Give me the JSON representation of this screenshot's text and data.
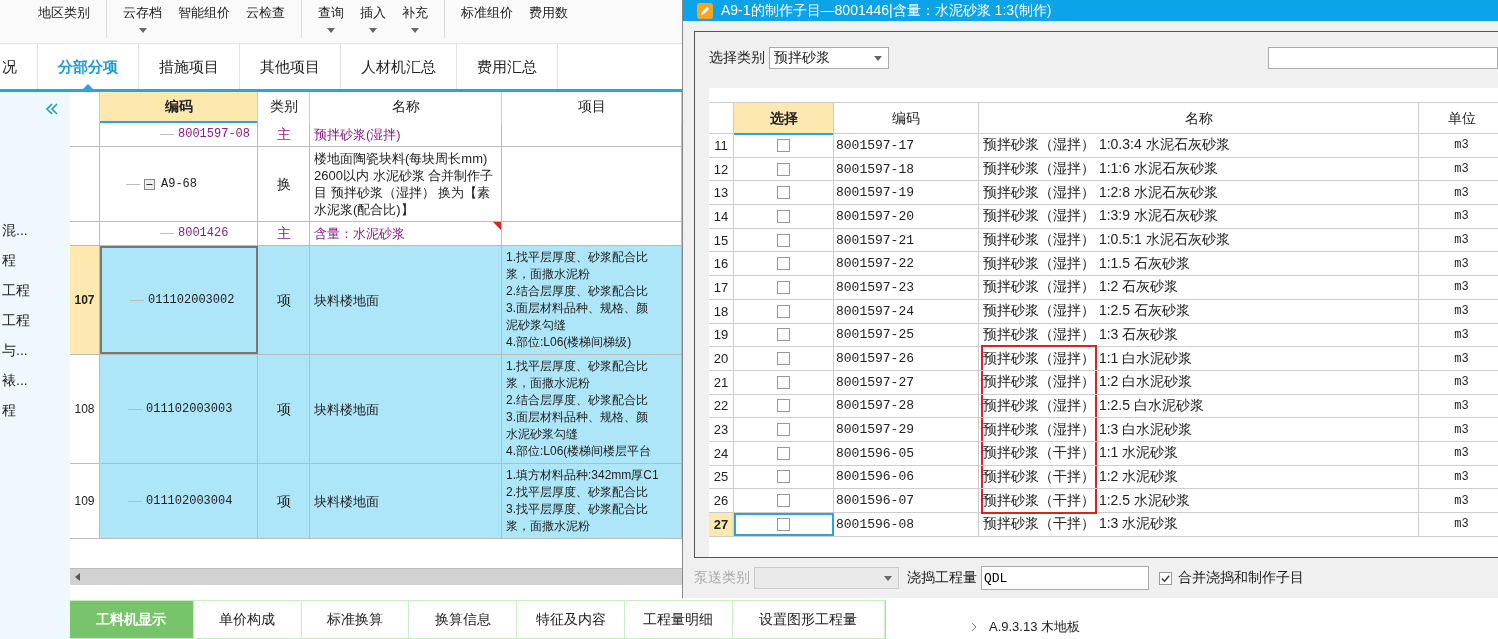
{
  "toolbar": [
    {
      "label": "地区类别",
      "caret": false
    },
    {
      "label": "云存档",
      "caret": true
    },
    {
      "label": "智能组价",
      "caret": false
    },
    {
      "label": "云检查",
      "caret": false
    },
    {
      "label": "查询",
      "caret": true
    },
    {
      "label": "插入",
      "caret": true
    },
    {
      "label": "补充",
      "caret": true
    },
    {
      "label": "标准组价",
      "caret": false
    },
    {
      "label": "费用数",
      "caret": false
    }
  ],
  "tabs": [
    {
      "label": "况",
      "selected": false
    },
    {
      "label": "分部分项",
      "selected": true
    },
    {
      "label": "措施项目",
      "selected": false
    },
    {
      "label": "其他项目",
      "selected": false
    },
    {
      "label": "人材机汇总",
      "selected": false
    },
    {
      "label": "费用汇总",
      "selected": false
    }
  ],
  "sidebar": {
    "items": [
      "混...",
      "程",
      "工程",
      "工程",
      "与...",
      "裱...",
      "程"
    ]
  },
  "grid": {
    "columns": [
      "编码",
      "类别",
      "名称",
      "项目"
    ],
    "rows": [
      {
        "kind": "material",
        "number": "",
        "code": "8001597-08",
        "type": "主",
        "name": "预拌砂浆(湿拌)",
        "selected": false,
        "has_note": false
      },
      {
        "kind": "sub",
        "number": "",
        "code": "A9-68",
        "expanded": true,
        "type": "换",
        "name": "楼地面陶瓷块料(每块周长mm) 2600以内 水泥砂浆 合并制作子目 预拌砂浆（湿拌） 换为【素水泥浆(配合比)】",
        "selected": false,
        "has_note": false
      },
      {
        "kind": "material",
        "number": "",
        "code": "8001426",
        "type": "主",
        "name": "含量：水泥砂浆",
        "selected": false,
        "has_note": true
      },
      {
        "kind": "item",
        "number": "107",
        "code": "011102003002",
        "type": "项",
        "name": "块料楼地面",
        "features": [
          "1.找平层厚度、砂浆配合比",
          "浆，面撒水泥粉",
          "2.结合层厚度、砂浆配合比",
          "3.面层材料品种、规格、颜",
          "泥砂浆勾缝",
          "4.部位:L06(楼梯间梯级)"
        ],
        "selected": true,
        "has_note": false
      },
      {
        "kind": "item",
        "number": "108",
        "code": "011102003003",
        "type": "项",
        "name": "块料楼地面",
        "features": [
          "1.找平层厚度、砂浆配合比",
          "浆，面撒水泥粉",
          "2.结合层厚度、砂浆配合比",
          "3.面层材料品种、规格、颜",
          "水泥砂浆勾缝",
          "4.部位:L06(楼梯间楼层平台"
        ],
        "selected": false,
        "has_note": false
      },
      {
        "kind": "item",
        "number": "109",
        "code": "011102003004",
        "type": "项",
        "name": "块料楼地面",
        "features": [
          "1.填方材料品种:342mm厚C1",
          "2.找平层厚度、砂浆配合比",
          "3.找平层厚度、砂浆配合比",
          "浆，面撒水泥粉"
        ],
        "selected": false,
        "has_note": false
      }
    ]
  },
  "bottom_tabs": [
    {
      "label": "工料机显示",
      "selected": true
    },
    {
      "label": "单价构成",
      "selected": false
    },
    {
      "label": "标准换算",
      "selected": false
    },
    {
      "label": "换算信息",
      "selected": false
    },
    {
      "label": "特征及内容",
      "selected": false
    },
    {
      "label": "工程量明细",
      "selected": false
    },
    {
      "label": "设置图形工程量",
      "selected": false
    }
  ],
  "tree": {
    "items": [
      "A.9.3.13 木地板"
    ]
  },
  "dialog": {
    "title": "A9-1的制作子目—8001446|含量：水泥砂浆 1:3(制作)",
    "category": {
      "label": "选择类别",
      "value": "预拌砂浆"
    },
    "columns": [
      "选择",
      "编码",
      "名称",
      "单位"
    ],
    "rows": [
      {
        "number": "11",
        "checked": false,
        "code": "8001597-17",
        "name": "预拌砂浆（湿拌） 1:0.3:4 水泥石灰砂浆",
        "unit": "m3",
        "selected": false,
        "marked": false
      },
      {
        "number": "12",
        "checked": false,
        "code": "8001597-18",
        "name": "预拌砂浆（湿拌） 1:1:6 水泥石灰砂浆",
        "unit": "m3",
        "selected": false,
        "marked": false
      },
      {
        "number": "13",
        "checked": false,
        "code": "8001597-19",
        "name": "预拌砂浆（湿拌） 1:2:8 水泥石灰砂浆",
        "unit": "m3",
        "selected": false,
        "marked": false
      },
      {
        "number": "14",
        "checked": false,
        "code": "8001597-20",
        "name": "预拌砂浆（湿拌） 1:3:9 水泥石灰砂浆",
        "unit": "m3",
        "selected": false,
        "marked": false
      },
      {
        "number": "15",
        "checked": false,
        "code": "8001597-21",
        "name": "预拌砂浆（湿拌） 1:0.5:1 水泥石灰砂浆",
        "unit": "m3",
        "selected": false,
        "marked": false
      },
      {
        "number": "16",
        "checked": false,
        "code": "8001597-22",
        "name": "预拌砂浆（湿拌） 1:1.5 石灰砂浆",
        "unit": "m3",
        "selected": false,
        "marked": false
      },
      {
        "number": "17",
        "checked": false,
        "code": "8001597-23",
        "name": "预拌砂浆（湿拌） 1:2 石灰砂浆",
        "unit": "m3",
        "selected": false,
        "marked": false
      },
      {
        "number": "18",
        "checked": false,
        "code": "8001597-24",
        "name": "预拌砂浆（湿拌） 1:2.5 石灰砂浆",
        "unit": "m3",
        "selected": false,
        "marked": false
      },
      {
        "number": "19",
        "checked": false,
        "code": "8001597-25",
        "name": "预拌砂浆（湿拌） 1:3 石灰砂浆",
        "unit": "m3",
        "selected": false,
        "marked": false
      },
      {
        "number": "20",
        "checked": false,
        "code": "8001597-26",
        "name": "预拌砂浆（湿拌） 1:1 白水泥砂浆",
        "unit": "m3",
        "selected": false,
        "marked": true
      },
      {
        "number": "21",
        "checked": false,
        "code": "8001597-27",
        "name": "预拌砂浆（湿拌） 1:2 白水泥砂浆",
        "unit": "m3",
        "selected": false,
        "marked": true
      },
      {
        "number": "22",
        "checked": false,
        "code": "8001597-28",
        "name": "预拌砂浆（湿拌） 1:2.5 白水泥砂浆",
        "unit": "m3",
        "selected": false,
        "marked": true
      },
      {
        "number": "23",
        "checked": false,
        "code": "8001597-29",
        "name": "预拌砂浆（湿拌） 1:3 白水泥砂浆",
        "unit": "m3",
        "selected": false,
        "marked": true
      },
      {
        "number": "24",
        "checked": false,
        "code": "8001596-05",
        "name": "预拌砂浆（干拌） 1:1 水泥砂浆",
        "unit": "m3",
        "selected": false,
        "marked": true
      },
      {
        "number": "25",
        "checked": false,
        "code": "8001596-06",
        "name": "预拌砂浆（干拌） 1:2 水泥砂浆",
        "unit": "m3",
        "selected": false,
        "marked": true
      },
      {
        "number": "26",
        "checked": false,
        "code": "8001596-07",
        "name": "预拌砂浆（干拌） 1:2.5 水泥砂浆",
        "unit": "m3",
        "selected": false,
        "marked": true
      },
      {
        "number": "27",
        "checked": false,
        "code": "8001596-08",
        "name": "预拌砂浆（干拌） 1:3 水泥砂浆",
        "unit": "m3",
        "selected": true,
        "marked": false
      }
    ],
    "pump_type": {
      "label": "泵送类别",
      "disabled": true
    },
    "pour_quantity": {
      "label": "浇捣工程量",
      "value": "QDL"
    },
    "merge": {
      "label": "合并浇捣和制作子目",
      "checked": true
    }
  }
}
